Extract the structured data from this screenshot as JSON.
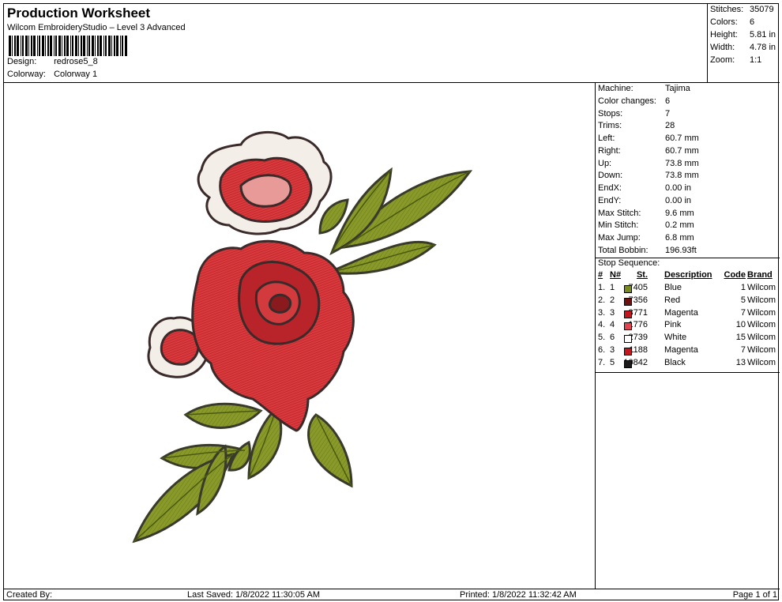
{
  "header": {
    "title": "Production Worksheet",
    "software": "Wilcom EmbroideryStudio – Level 3 Advanced",
    "design_label": "Design:",
    "design_value": "redrose5_8",
    "colorway_label": "Colorway:",
    "colorway_value": "Colorway 1"
  },
  "summary": [
    {
      "label": "Stitches:",
      "value": "35079"
    },
    {
      "label": "Colors:",
      "value": "6"
    },
    {
      "label": "Height:",
      "value": "5.81 in"
    },
    {
      "label": "Width:",
      "value": "4.78 in"
    },
    {
      "label": "Zoom:",
      "value": "1:1"
    }
  ],
  "stats": [
    {
      "label": "Machine:",
      "value": "Tajima"
    },
    {
      "label": "Color changes:",
      "value": "6"
    },
    {
      "label": "Stops:",
      "value": "7"
    },
    {
      "label": "Trims:",
      "value": "28"
    },
    {
      "label": "Left:",
      "value": "60.7 mm"
    },
    {
      "label": "Right:",
      "value": "60.7 mm"
    },
    {
      "label": "Up:",
      "value": "73.8 mm"
    },
    {
      "label": "Down:",
      "value": "73.8 mm"
    },
    {
      "label": "EndX:",
      "value": "0.00 in"
    },
    {
      "label": "EndY:",
      "value": "0.00 in"
    },
    {
      "label": "Max Stitch:",
      "value": "9.6 mm"
    },
    {
      "label": "Min Stitch:",
      "value": "0.2 mm"
    },
    {
      "label": "Max Jump:",
      "value": "6.8 mm"
    },
    {
      "label": "Total Bobbin:",
      "value": "196.93ft"
    }
  ],
  "stop_sequence": {
    "title": "Stop Sequence:",
    "headers": {
      "num": "#",
      "n": "N#",
      "st": "St.",
      "desc": "Description",
      "code": "Code",
      "brand": "Brand"
    },
    "rows": [
      {
        "num": "1.",
        "n": "1",
        "color": "#7a8a1e",
        "st": "7405",
        "desc": "Blue",
        "code": "1",
        "brand": "Wilcom"
      },
      {
        "num": "2.",
        "n": "2",
        "color": "#6e0f12",
        "st": "7356",
        "desc": "Red",
        "code": "5",
        "brand": "Wilcom"
      },
      {
        "num": "3.",
        "n": "3",
        "color": "#c4161c",
        "st": "3771",
        "desc": "Magenta",
        "code": "7",
        "brand": "Wilcom"
      },
      {
        "num": "4.",
        "n": "4",
        "color": "#e04450",
        "st": "1776",
        "desc": "Pink",
        "code": "10",
        "brand": "Wilcom"
      },
      {
        "num": "5.",
        "n": "6",
        "color": "#ffffff",
        "st": "2739",
        "desc": "White",
        "code": "15",
        "brand": "Wilcom"
      },
      {
        "num": "6.",
        "n": "3",
        "color": "#c4161c",
        "st": "1188",
        "desc": "Magenta",
        "code": "7",
        "brand": "Wilcom"
      },
      {
        "num": "7.",
        "n": "5",
        "color": "#1a1a1a",
        "st": "10842",
        "desc": "Black",
        "code": "13",
        "brand": "Wilcom"
      }
    ]
  },
  "footer": {
    "created": "Created By:",
    "saved": "Last Saved: 1/8/2022 11:30:05 AM",
    "printed": "Printed: 1/8/2022 11:32:42 AM",
    "page": "Page 1 of 1"
  }
}
